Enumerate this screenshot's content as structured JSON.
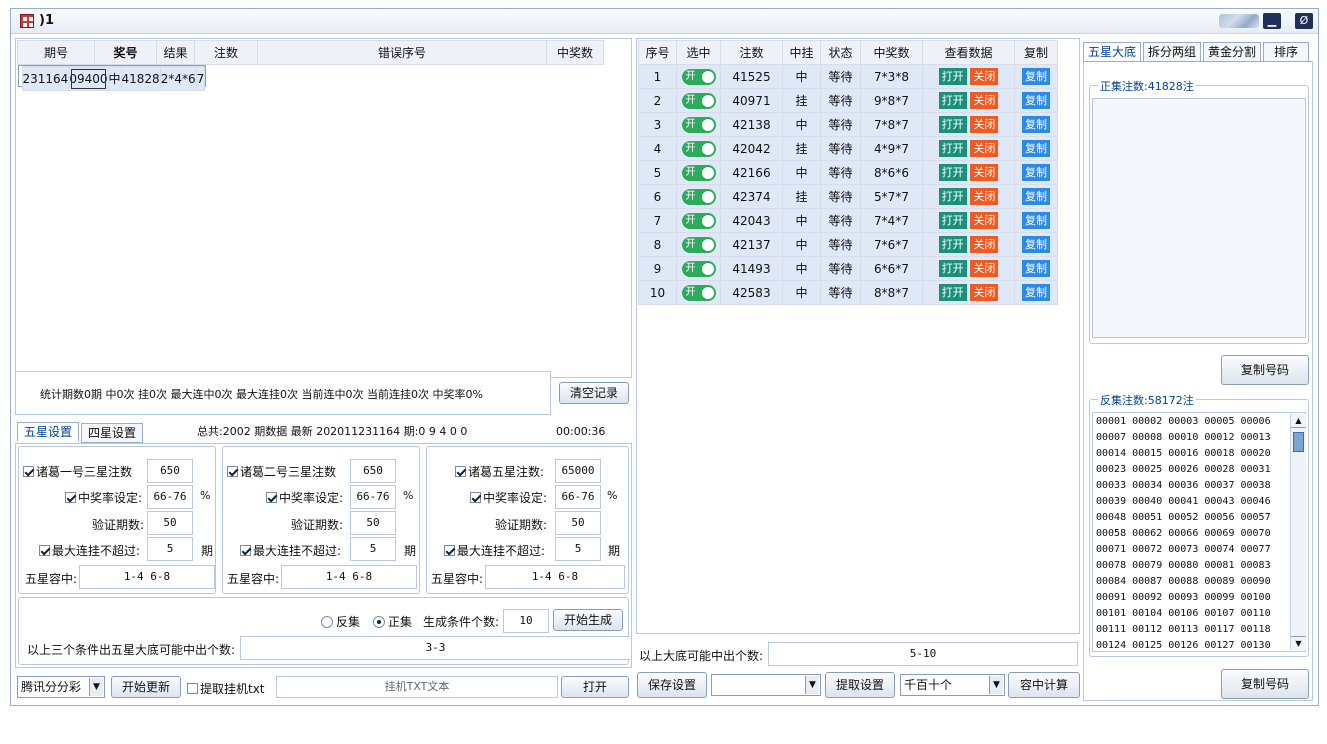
{
  "window": {
    "title": ")1",
    "minimize": "▁",
    "close": "Ø"
  },
  "left_table": {
    "headers": [
      "期号",
      "奖号",
      "结果",
      "注数",
      "错误序号",
      "中奖数"
    ],
    "row": {
      "period": "231164",
      "number": "09400",
      "result": "中",
      "count": "41828",
      "error": "2*4*6",
      "wins": "7"
    }
  },
  "stats": {
    "text": "统计期数0期 中0次 挂0次 最大连中0次 最大连挂0次 当前连中0次 当前连挂0次 中奖率0%",
    "clear_btn": "清空记录"
  },
  "settings_tabs": [
    "五星设置",
    "四星设置"
  ],
  "summary": {
    "text": "总共:2002 期数据 最新 202011231164 期:0 9 4 0 0",
    "timer": "00:00:36"
  },
  "groups": [
    {
      "label1": "诸葛一号三星注数",
      "v1": "650",
      "label2": "中奖率设定:",
      "v2": "66-76",
      "pct": "%",
      "label3": "验证期数:",
      "v3": "50",
      "label4": "最大连挂不超过:",
      "v4": "5",
      "unit": "期",
      "label5": "五星容中:",
      "v5": "1-4 6-8"
    },
    {
      "label1": "诸葛二号三星注数",
      "v1": "650",
      "label2": "中奖率设定:",
      "v2": "66-76",
      "pct": "%",
      "label3": "验证期数:",
      "v3": "50",
      "label4": "最大连挂不超过:",
      "v4": "5",
      "unit": "期",
      "label5": "五星容中:",
      "v5": "1-4 6-8"
    },
    {
      "label1": "诸葛五星注数:",
      "v1": "65000",
      "label2": "中奖率设定:",
      "v2": "66-76",
      "pct": "%",
      "label3": "验证期数:",
      "v3": "50",
      "label4": "最大连挂不超过:",
      "v4": "5",
      "unit": "期",
      "label5": "五星容中:",
      "v5": "1-4 6-8"
    }
  ],
  "generate": {
    "reverse": "反集",
    "forward": "正集",
    "cond_label": "生成条件个数:",
    "cond_val": "10",
    "start_btn": "开始生成",
    "possible_label": "以上三个条件出五星大底可能中出个数:",
    "possible_val": "3-3"
  },
  "bottom_left": {
    "source": "腾讯分分彩",
    "update_btn": "开始更新",
    "hang_label": "提取挂机txt",
    "hang_placeholder": "挂机TXT文本",
    "open_btn": "打开"
  },
  "mid_table": {
    "headers": [
      "序号",
      "选中",
      "注数",
      "中挂",
      "状态",
      "中奖数",
      "查看数据",
      "复制"
    ],
    "toggle": "开",
    "open": "打开",
    "close": "关闭",
    "copy": "复制",
    "rows": [
      {
        "n": "1",
        "count": "41525",
        "res": "中",
        "status": "等待",
        "win": "7*3*8"
      },
      {
        "n": "2",
        "count": "40971",
        "res": "挂",
        "status": "等待",
        "win": "9*8*7"
      },
      {
        "n": "3",
        "count": "42138",
        "res": "中",
        "status": "等待",
        "win": "7*8*7"
      },
      {
        "n": "4",
        "count": "42042",
        "res": "挂",
        "status": "等待",
        "win": "4*9*7"
      },
      {
        "n": "5",
        "count": "42166",
        "res": "中",
        "status": "等待",
        "win": "8*6*6"
      },
      {
        "n": "6",
        "count": "42374",
        "res": "挂",
        "status": "等待",
        "win": "5*7*7"
      },
      {
        "n": "7",
        "count": "42043",
        "res": "中",
        "status": "等待",
        "win": "7*4*7"
      },
      {
        "n": "8",
        "count": "42137",
        "res": "中",
        "status": "等待",
        "win": "7*6*7"
      },
      {
        "n": "9",
        "count": "41493",
        "res": "中",
        "status": "等待",
        "win": "6*6*7"
      },
      {
        "n": "10",
        "count": "42583",
        "res": "中",
        "status": "等待",
        "win": "8*8*7"
      }
    ]
  },
  "mid_bottom": {
    "possible_label": "以上大底可能中出个数:",
    "possible_val": "5-10",
    "save_btn": "保存设置",
    "fetch_btn": "提取设置",
    "digits": "千百十个",
    "calc_btn": "容中计算"
  },
  "right": {
    "tabs": [
      "五星大底",
      "拆分两组",
      "黄金分割",
      "排序"
    ],
    "pos_label": "正集注数:41828注",
    "copy_btn": "复制号码",
    "neg_label": "反集注数:58172注",
    "copy_btn2": "复制号码",
    "codes": [
      "00001 00002 00003 00005 00006",
      "00007 00008 00010 00012 00013",
      "00014 00015 00016 00018 00020",
      "00023 00025 00026 00028 00031",
      "00033 00034 00036 00037 00038",
      "00039 00040 00041 00043 00046",
      "00048 00051 00052 00056 00057",
      "00058 00062 00066 00069 00070",
      "00071 00072 00073 00074 00077",
      "00078 00079 00080 00081 00083",
      "00084 00087 00088 00089 00090",
      "00091 00092 00093 00099 00100",
      "00101 00104 00106 00107 00110",
      "00111 00112 00113 00117 00118",
      "00124 00125 00126 00127 00130"
    ]
  }
}
